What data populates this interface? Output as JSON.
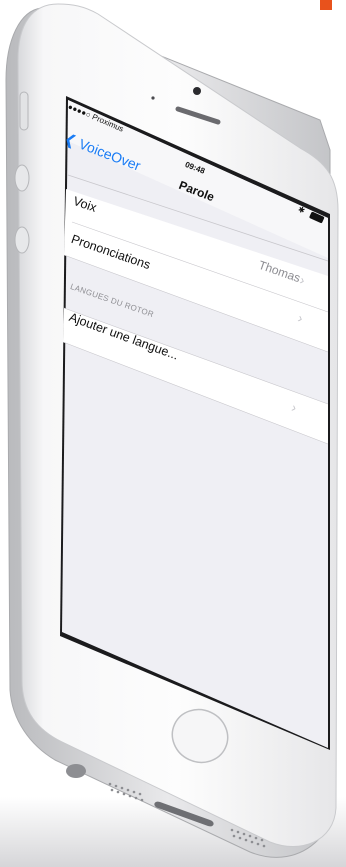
{
  "status_bar": {
    "carrier": "●●●●○ Proximus",
    "time": "09:48"
  },
  "nav": {
    "back_label": "VoiceOver",
    "title": "Parole"
  },
  "rows": [
    {
      "label": "Voix",
      "detail": "Thomas"
    },
    {
      "label": "Prononciations",
      "detail": ""
    }
  ],
  "rotor_section": {
    "header": "LANGUES DU ROTOR",
    "add_label": "Ajouter une langue..."
  },
  "colors": {
    "accent": "#e8521c",
    "tint": "#1a7cf5",
    "group_bg": "#efeff4"
  }
}
